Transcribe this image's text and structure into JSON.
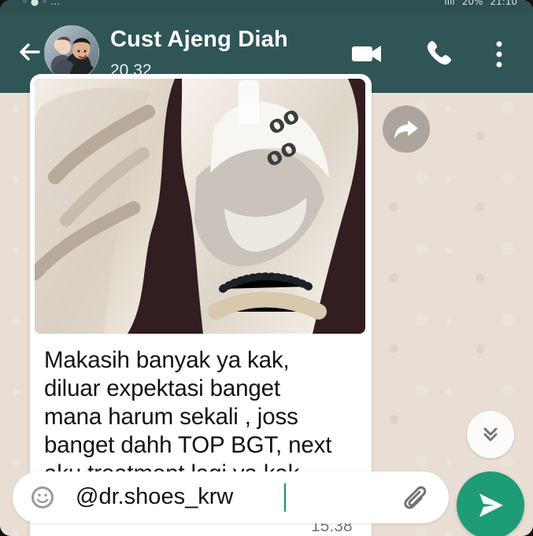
{
  "status_bar": {
    "left": "◦ ● ◦ …",
    "signal": "ııll",
    "battery": "20%",
    "clock": "21:10"
  },
  "chat": {
    "contact_name": "Cust Ajeng Diah",
    "last_seen": "20.32",
    "photo_caption": "",
    "message_text": "Makasih banyak ya kak,\ndiluar expektasi banget\nmana harum sekali , joss\nbanget dahh TOP BGT, next\naku treatment lagi ya kak",
    "message_emoji": "🥳",
    "message_time": "15.38"
  },
  "composer": {
    "text": "@dr.shoes_krw",
    "placeholder": ""
  },
  "icons": {
    "back": "arrow-left-icon",
    "video": "video-camera-icon",
    "call": "phone-icon",
    "menu": "more-vertical-icon",
    "forward": "forward-arrow-icon",
    "scroll": "double-chevron-down-icon",
    "emoji": "emoji-icon",
    "attach": "paperclip-icon",
    "send": "send-arrow-icon"
  },
  "colors": {
    "header": "#2f5557",
    "chat_background": "#e8ded3",
    "message_bubble": "#ffffff",
    "send_button": "#1e9b77"
  }
}
